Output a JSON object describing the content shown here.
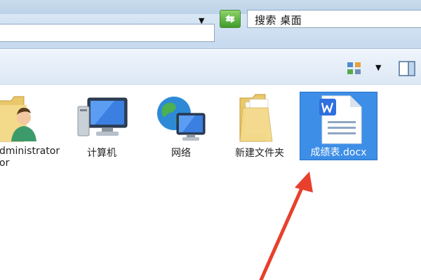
{
  "address_bar": {
    "dropdown_glyph": "▼"
  },
  "search": {
    "text": "搜索 桌面"
  },
  "toolbar": {
    "view_dropdown_glyph": "▼"
  },
  "desktop_items": [
    {
      "label": "dministrator\nor",
      "icon": "user-folder-icon"
    },
    {
      "label": "计算机",
      "icon": "computer-icon"
    },
    {
      "label": "网络",
      "icon": "network-icon"
    },
    {
      "label": "新建文件夹",
      "icon": "folder-icon"
    },
    {
      "label": "成绩表.docx",
      "icon": "wps-document-icon",
      "selected": true
    }
  ],
  "colors": {
    "selection": "#3d8ee6",
    "arrow": "#e8402c",
    "wps_blue": "#2f6fe0"
  }
}
